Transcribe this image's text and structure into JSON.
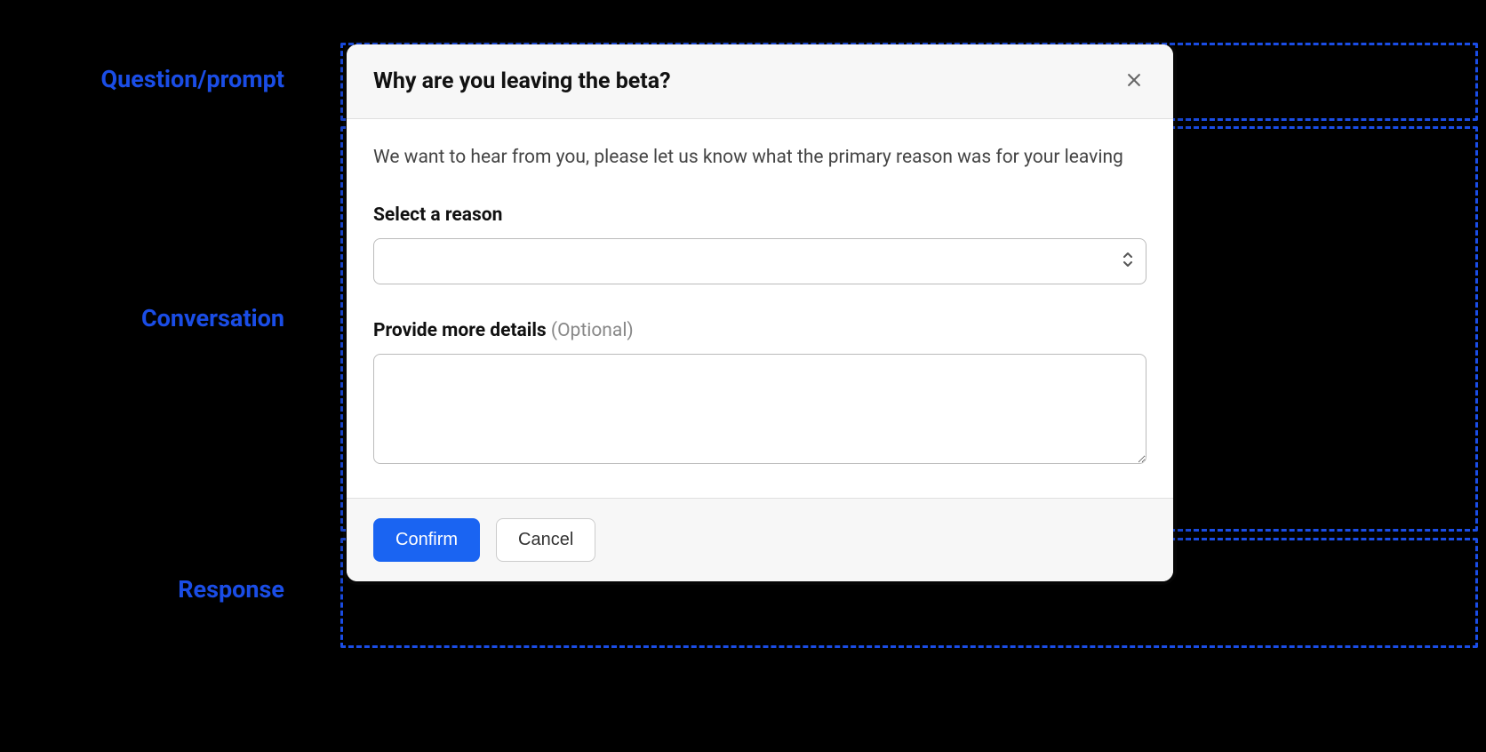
{
  "annotations": {
    "question": "Question/prompt",
    "conversation": "Conversation",
    "response": "Response"
  },
  "modal": {
    "title": "Why are you leaving the beta?",
    "description": "We want to hear from you, please let us know what the primary reason was for your leaving",
    "select_label": "Select a reason",
    "select_value": "",
    "details_label": "Provide more details ",
    "details_optional": "(Optional)",
    "details_value": "",
    "confirm_label": "Confirm",
    "cancel_label": "Cancel"
  }
}
